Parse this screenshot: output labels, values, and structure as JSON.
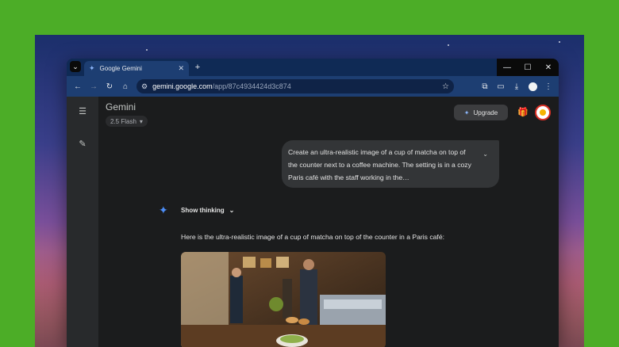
{
  "browser": {
    "tab_title": "Google Gemini",
    "url_host": "gemini.google.com",
    "url_path": "/app/87c4934424d3c874"
  },
  "app": {
    "title": "Gemini",
    "model": "2.5 Flash",
    "upgrade_label": "Upgrade"
  },
  "chat": {
    "user_message": "Create an ultra-realistic image of a cup of matcha on top of the counter next to a coffee machine. The setting is in a cozy Paris café with the staff working in the…",
    "show_thinking": "Show thinking",
    "response_text": "Here is the ultra-realistic image of a cup of matcha on top of the counter in a Paris café:"
  },
  "colors": {
    "accent": "#4c8df6",
    "tabstrip": "#0f2a55",
    "toolbar": "#1d3e72",
    "page_bg": "#1b1c1d",
    "desktop": "#4cad27"
  },
  "icons": {
    "tab_menu": "chevron-down-icon",
    "back": "arrow-left-icon",
    "forward": "arrow-right-icon",
    "reload": "reload-icon",
    "home": "home-icon",
    "site_info": "tune-icon",
    "bookmark": "star-icon",
    "extensions": "puzzle-icon",
    "cast": "cast-icon",
    "download": "download-icon",
    "menu": "kebab-icon",
    "sidebar_menu": "hamburger-icon",
    "new_chat": "edit-icon",
    "gift": "gift-icon"
  }
}
